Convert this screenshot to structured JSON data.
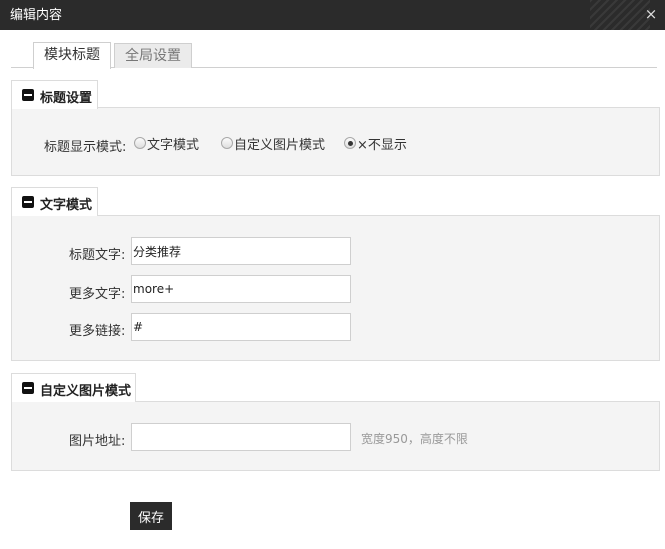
{
  "window": {
    "title": "编辑内容",
    "close_glyph": "×"
  },
  "tabs": [
    {
      "label": "模块标题",
      "active": true
    },
    {
      "label": "全局设置",
      "active": false
    }
  ],
  "sections": {
    "title_settings": {
      "header": "标题设置",
      "mode_label": "标题显示模式:",
      "options": [
        {
          "label": "文字模式",
          "checked": false
        },
        {
          "label": "自定义图片模式",
          "checked": false
        },
        {
          "label": "×不显示",
          "checked": true
        }
      ]
    },
    "text_mode": {
      "header": "文字模式",
      "title_text_label": "标题文字:",
      "title_text_value": "分类推荐",
      "more_text_label": "更多文字:",
      "more_text_value": "more+",
      "more_link_label": "更多链接:",
      "more_link_value": "#"
    },
    "image_mode": {
      "header": "自定义图片模式",
      "image_url_label": "图片地址:",
      "image_url_value": "",
      "image_hint": "宽度950，高度不限"
    }
  },
  "actions": {
    "save_label": "保存"
  }
}
